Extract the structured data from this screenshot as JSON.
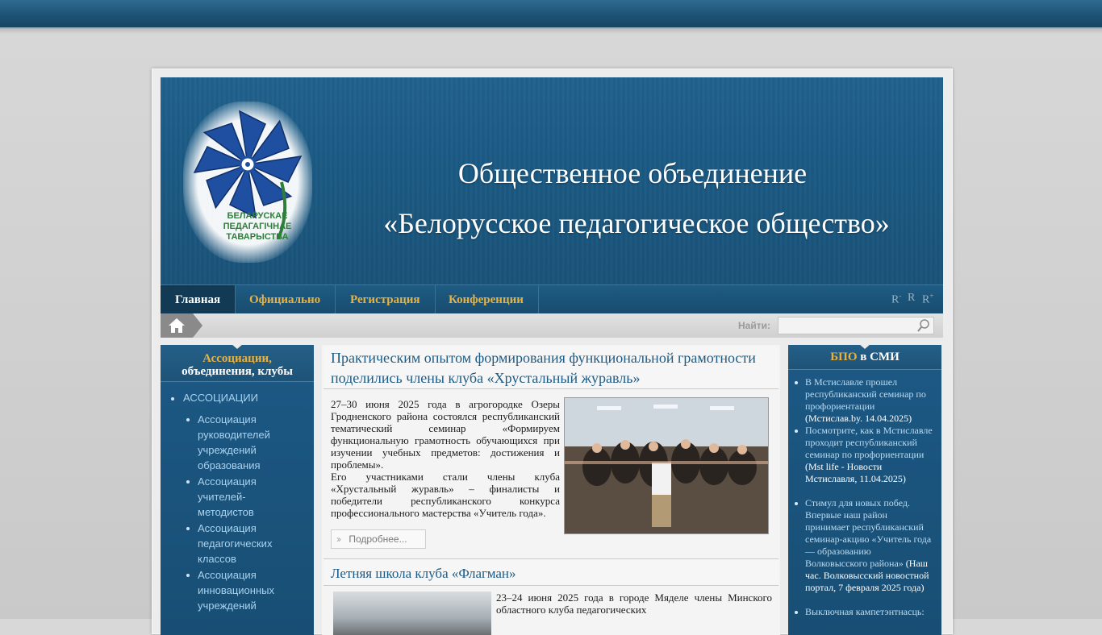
{
  "header": {
    "title_line1": "Общественное объединение",
    "title_line2": "«Белорусское педагогическое общество»",
    "logo_text": [
      "БЕЛАРУСКАЕ",
      "ПЕДАГАГІЧНАЕ",
      "ТАВАРЫСТВА"
    ]
  },
  "nav": {
    "items": [
      "Главная",
      "Официально",
      "Регистрация",
      "Конференции"
    ],
    "font_controls": [
      "R",
      "R",
      "R"
    ]
  },
  "search": {
    "label": "Найти:",
    "value": ""
  },
  "left_column": {
    "title_part1": "Ассоциации,",
    "title_part2": "объединения, клубы",
    "top_item": "АССОЦИАЦИИ",
    "sub_items": [
      "Ассоциация руководителей учреждений образования",
      "Ассоциация учителей-методистов",
      "Ассоциация педагогических классов",
      "Ассоциация инновационных учреждений"
    ]
  },
  "articles": [
    {
      "title": "Практическим опытом формирования функциональной грамотности поделились члены клуба «Хрустальный журавль»",
      "p1": "27–30 июня 2025 года в агрогородке Озеры Гродненского района состоялся республиканский тематический семинар «Формируем функциональную грамотность обучающихся при изучении учебных предметов: достижения и проблемы».",
      "p2": "Его участниками стали члены клуба «Хрустальный журавль» – финалисты и победители республиканского конкурса профессионального мастерства «Учитель года».",
      "more": "Подробнее..."
    },
    {
      "title": "Летняя школа клуба «Флагман»",
      "p1": "23–24 июня 2025 года в городе Мяделе члены Минского областного клуба педагогических"
    }
  ],
  "right_column": {
    "title_part1": "БПО",
    "title_part2": " в СМИ",
    "news": [
      {
        "link": "В Мстиславле прошел республиканский семинар по профориентации",
        "source": "(Мстислав.by. 14.04.2025)"
      },
      {
        "link": "Посмотрите, как в Мстиславле проходит республиканский семинар по профориентации",
        "source": "(Mst life - Новости Мстиславля, 11.04.2025)"
      },
      {
        "link": "Стимул для новых побед. Впервые наш район принимает республиканский семинар-акцию «Учитель года — образованию Волковысского района»",
        "source": "(Наш час. Волковысский новостной портал, 7 февраля 2025 года)"
      },
      {
        "link": "Выключная кампетэнтнасць:",
        "source": ""
      }
    ]
  },
  "colors": {
    "header_blue": "#1b5a84",
    "nav_gold": "#e9b23f",
    "link_blue": "#1c5b85",
    "sidebar_link": "#a9d2ee"
  }
}
